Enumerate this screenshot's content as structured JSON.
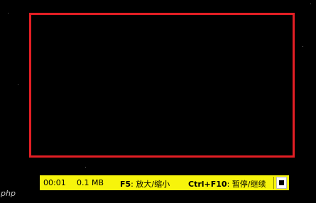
{
  "recorder": {
    "timer": "00:01",
    "file_size": "0.1 MB",
    "zoom_key": "F5",
    "zoom_label": ": 放大/缩小",
    "pause_key": "Ctrl+F10",
    "pause_label": ": 暂停/继续"
  },
  "icons": {
    "stop": "stop-icon"
  },
  "colors": {
    "region_border": "#e31e24",
    "bar_background": "#f7f40b"
  },
  "watermark": "php"
}
